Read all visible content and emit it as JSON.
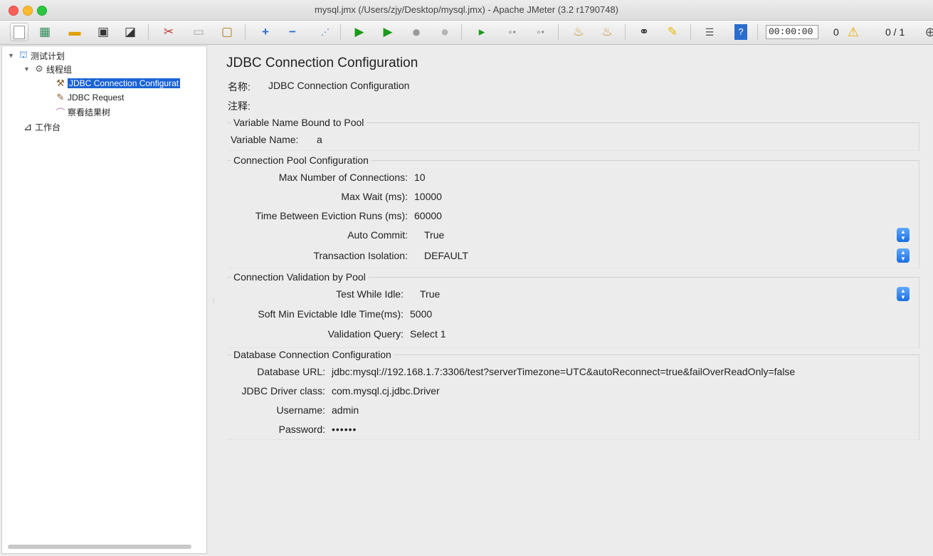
{
  "window": {
    "title": "mysql.jmx (/Users/zjy/Desktop/mysql.jmx) - Apache JMeter (3.2 r1790748)"
  },
  "toolbar": {
    "timer": "00:00:00",
    "warn_count": "0",
    "threads": "0 / 1",
    "icons": [
      "new-icon",
      "templates-icon",
      "open-icon",
      "save-icon",
      "save-as-icon",
      "cut-icon",
      "copy-icon",
      "paste-icon",
      "expand-icon",
      "collapse-icon",
      "toggle-icon",
      "start-icon",
      "start-no-pause-icon",
      "stop-icon",
      "shutdown-icon",
      "remote-start-icon",
      "remote-stop-icon",
      "remote-shutdown-icon",
      "clear-icon",
      "clear-all-icon",
      "search-icon",
      "reset-search-icon",
      "function-helper-icon",
      "help-icon",
      "warning-icon",
      "globe-icon"
    ]
  },
  "tree": {
    "items": [
      {
        "label": "测试计划"
      },
      {
        "label": "线程组"
      },
      {
        "label": "JDBC Connection Configurat"
      },
      {
        "label": "JDBC Request"
      },
      {
        "label": "察看结果树"
      },
      {
        "label": "工作台"
      }
    ]
  },
  "panel": {
    "title": "JDBC Connection Configuration",
    "name_label": "名称:",
    "name_value": "JDBC Connection Configuration",
    "comment_label": "注释:",
    "groups": {
      "variable": {
        "title": "Variable Name Bound to Pool",
        "var_name_label": "Variable Name:",
        "var_name_value": "a"
      },
      "pool": {
        "title": "Connection Pool Configuration",
        "max_conn_label": "Max Number of Connections:",
        "max_conn_value": "10",
        "max_wait_label": "Max Wait (ms):",
        "max_wait_value": "10000",
        "eviction_label": "Time Between Eviction Runs (ms):",
        "eviction_value": "60000",
        "auto_commit_label": "Auto Commit:",
        "auto_commit_value": "True",
        "isolation_label": "Transaction Isolation:",
        "isolation_value": "DEFAULT"
      },
      "validation": {
        "title": "Connection Validation by Pool",
        "test_idle_label": "Test While Idle:",
        "test_idle_value": "True",
        "soft_min_label": "Soft Min Evictable Idle Time(ms):",
        "soft_min_value": "5000",
        "query_label": "Validation Query:",
        "query_value": "Select 1"
      },
      "database": {
        "title": "Database Connection Configuration",
        "url_label": "Database URL:",
        "url_value": "jdbc:mysql://192.168.1.7:3306/test?serverTimezone=UTC&autoReconnect=true&failOverReadOnly=false",
        "driver_label": "JDBC Driver class:",
        "driver_value": "com.mysql.cj.jdbc.Driver",
        "username_label": "Username:",
        "username_value": "admin",
        "password_label": "Password:",
        "password_value": "••••••"
      }
    }
  }
}
